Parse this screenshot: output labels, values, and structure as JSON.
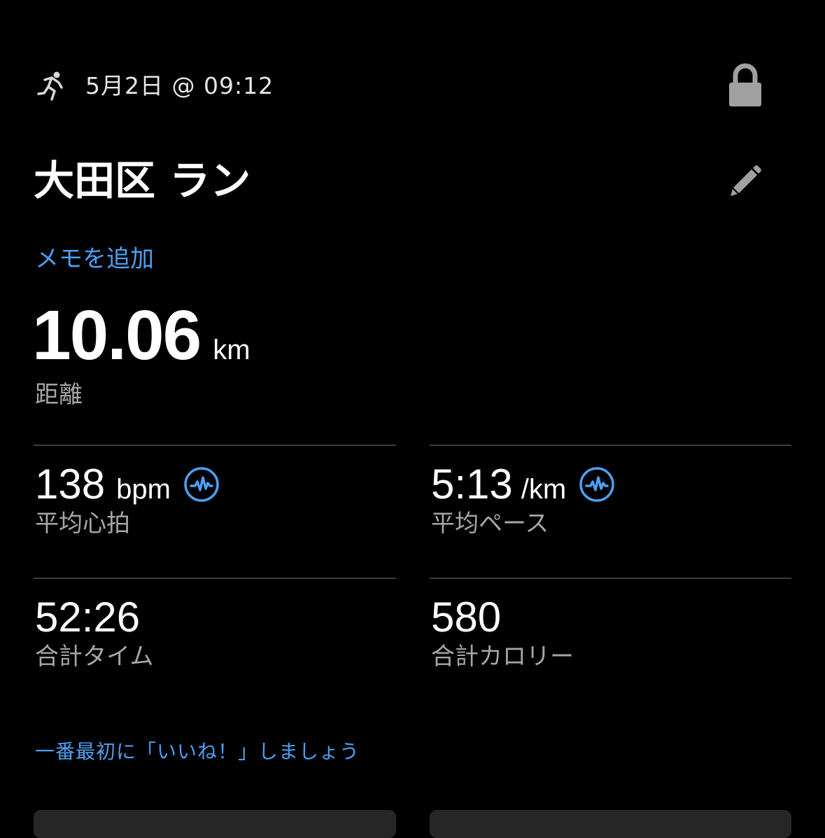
{
  "header": {
    "activity_icon": "running-person-icon",
    "datetime": "5月2日 @ 09:12",
    "lock_icon": "lock-icon"
  },
  "activity": {
    "title": "大田区 ラン",
    "edit_icon": "pencil-icon",
    "memo_link": "メモを追加"
  },
  "distance": {
    "value": "10.06",
    "unit": "km",
    "label": "距離"
  },
  "stats": {
    "heart_rate": {
      "value": "138",
      "unit": "bpm",
      "label": "平均心拍",
      "icon": "chart-wave-icon"
    },
    "pace": {
      "value": "5:13",
      "unit": "/km",
      "label": "平均ペース",
      "icon": "chart-wave-icon"
    },
    "total_time": {
      "value": "52:26",
      "label": "合計タイム"
    },
    "calories": {
      "value": "580",
      "label": "合計カロリー"
    }
  },
  "social": {
    "like_prompt": "一番最初に「いいね！」しましょう"
  },
  "colors": {
    "background": "#000000",
    "accent_blue": "#4d9ff2",
    "secondary_text": "#a6a6a6",
    "divider": "#3d3d3d",
    "icon_gray": "#a0a0a0"
  }
}
